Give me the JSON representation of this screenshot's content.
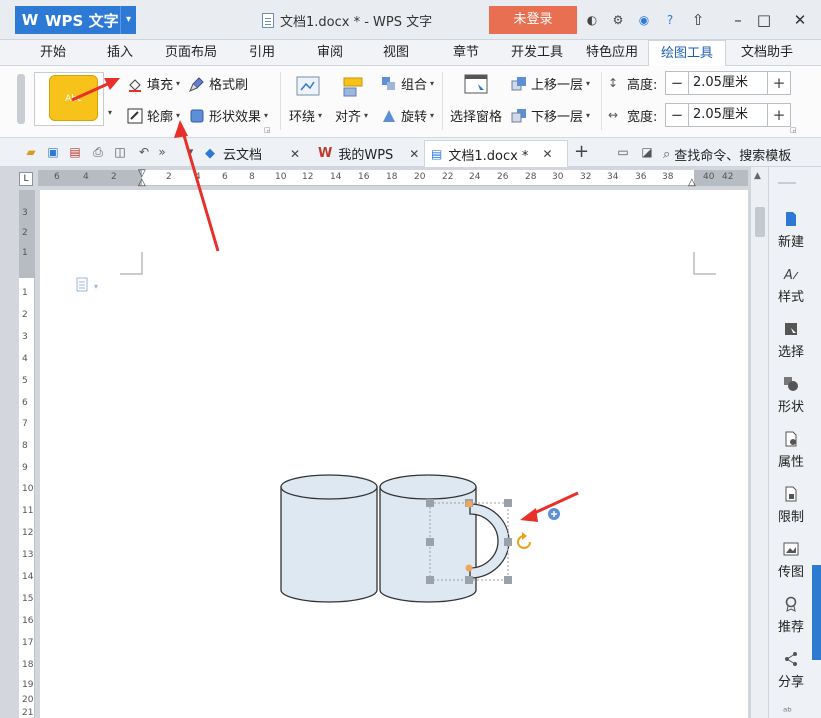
{
  "titlebar": {
    "app_name": "WPS 文字",
    "logo_letter": "W",
    "document_title": "文档1.docx * - WPS 文字",
    "login_button": "未登录"
  },
  "menu": {
    "tabs": [
      "开始",
      "插入",
      "页面布局",
      "引用",
      "审阅",
      "视图",
      "章节",
      "开发工具",
      "特色应用",
      "绘图工具",
      "文档助手"
    ],
    "active_tab": "绘图工具"
  },
  "ribbon": {
    "fill_preview_text": "Abc",
    "fill_label": "填充",
    "format_painter_label": "格式刷",
    "outline_label": "轮廓",
    "shape_effect_label": "形状效果",
    "wrap_label": "环绕",
    "align_label": "对齐",
    "group_label": "组合",
    "rotate_label": "旋转",
    "selection_pane_label": "选择窗格",
    "bring_forward_label": "上移一层",
    "send_backward_label": "下移一层",
    "height_label": "高度:",
    "height_value": "2.05厘米",
    "width_label": "宽度:",
    "width_value": "2.05厘米"
  },
  "doc_tabs": [
    {
      "label": "云文档"
    },
    {
      "label": "我的WPS"
    },
    {
      "label": "文档1.docx *"
    }
  ],
  "search": {
    "label": "查找命令、搜索模板"
  },
  "ruler": {
    "h_numbers": [
      "6",
      "4",
      "2",
      "2",
      "4",
      "6",
      "8",
      "10",
      "12",
      "14",
      "16",
      "18",
      "20",
      "22",
      "24",
      "26",
      "28",
      "30",
      "32",
      "34",
      "36",
      "38",
      "40",
      "42"
    ],
    "v_numbers": [
      "3",
      "2",
      "1",
      "1",
      "2",
      "3",
      "4",
      "5",
      "6",
      "7",
      "8",
      "9",
      "10",
      "11",
      "12",
      "13",
      "14",
      "15",
      "16",
      "17",
      "18",
      "19",
      "20",
      "21"
    ],
    "corner_label": "L"
  },
  "task_pane": {
    "items": [
      "新建",
      "样式",
      "选择",
      "形状",
      "属性",
      "限制",
      "传图",
      "推荐",
      "分享"
    ]
  },
  "colors": {
    "accent": "#2d7ad6",
    "login": "#e86f52",
    "mug_fill": "#dde8f2",
    "arrow": "#e8302a",
    "handle": "#9aa1aa"
  }
}
